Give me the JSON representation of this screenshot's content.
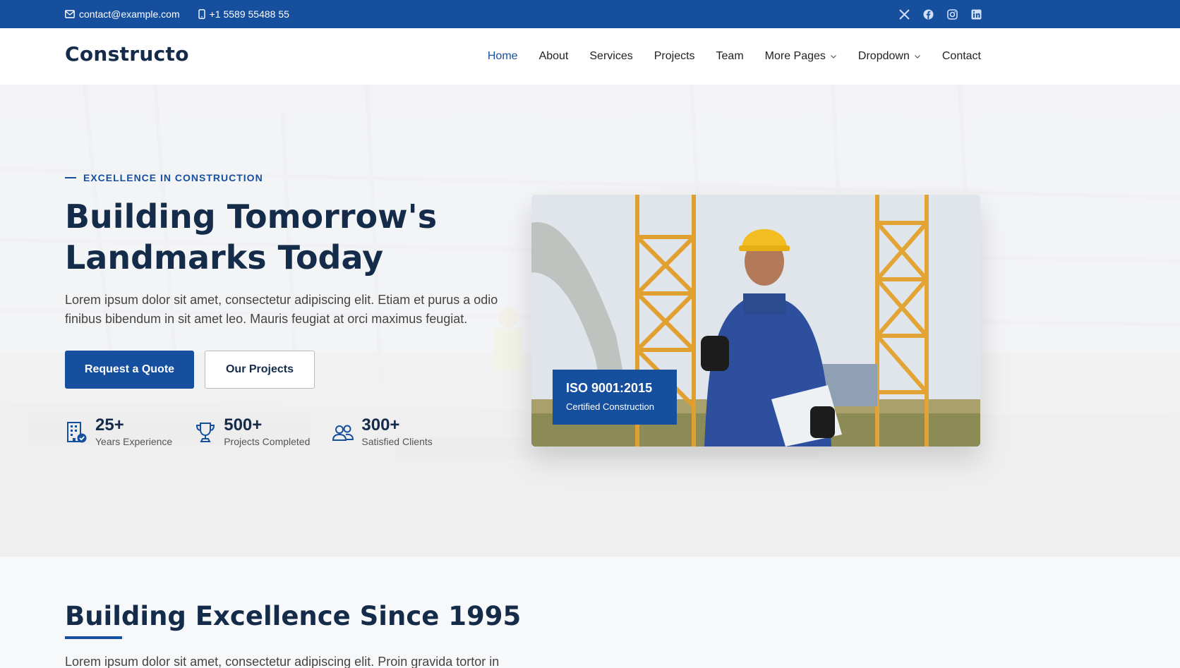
{
  "topbar": {
    "email": "contact@example.com",
    "phone": "+1 5589 55488 55",
    "social": [
      "x-icon",
      "facebook-icon",
      "instagram-icon",
      "linkedin-icon"
    ]
  },
  "header": {
    "logo": "Constructo",
    "nav": [
      {
        "label": "Home",
        "active": true
      },
      {
        "label": "About"
      },
      {
        "label": "Services"
      },
      {
        "label": "Projects"
      },
      {
        "label": "Team"
      },
      {
        "label": "More Pages",
        "dropdown": true
      },
      {
        "label": "Dropdown",
        "dropdown": true
      },
      {
        "label": "Contact"
      }
    ]
  },
  "hero": {
    "eyebrow": "EXCELLENCE IN CONSTRUCTION",
    "title": "Building Tomorrow's Landmarks Today",
    "lead": "Lorem ipsum dolor sit amet, consectetur adipiscing elit. Etiam et purus a odio finibus bibendum in sit amet leo. Mauris feugiat at orci maximus feugiat.",
    "primary_button": "Request a Quote",
    "secondary_button": "Our Projects",
    "stats": [
      {
        "icon": "building-check-icon",
        "value": "25+",
        "label": "Years Experience"
      },
      {
        "icon": "trophy-icon",
        "value": "500+",
        "label": "Projects Completed"
      },
      {
        "icon": "people-icon",
        "value": "300+",
        "label": "Satisfied Clients"
      }
    ],
    "badge": {
      "title": "ISO 9001:2015",
      "subtitle": "Certified Construction"
    }
  },
  "about": {
    "title": "Building Excellence Since 1995",
    "text": "Lorem ipsum dolor sit amet, consectetur adipiscing elit. Proin gravida tortor in"
  },
  "colors": {
    "primary": "#164f9e",
    "heading": "#152b4a"
  }
}
